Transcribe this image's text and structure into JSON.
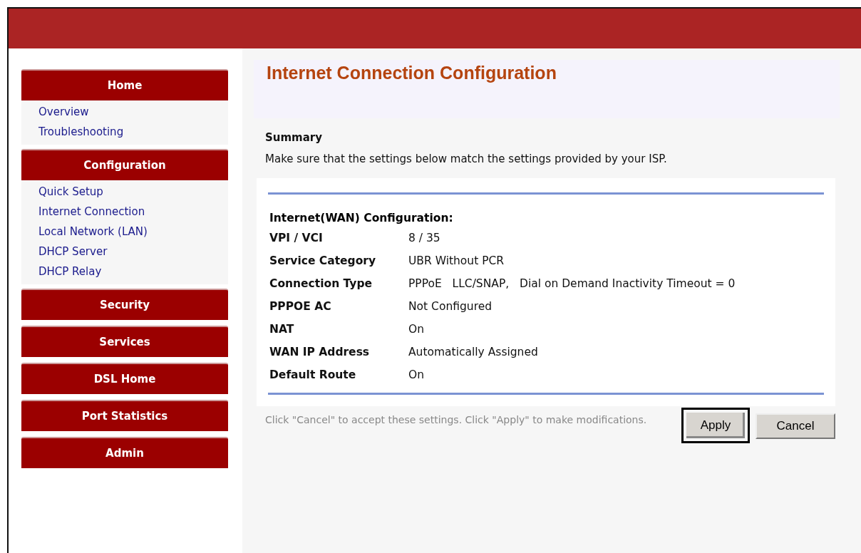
{
  "sidebar": {
    "sections": [
      {
        "title": "Home",
        "items": [
          "Overview",
          "Troubleshooting"
        ]
      },
      {
        "title": "Configuration",
        "items": [
          "Quick Setup",
          "Internet Connection",
          "Local Network (LAN)",
          "DHCP Server",
          "DHCP Relay"
        ]
      },
      {
        "title": "Security"
      },
      {
        "title": "Services"
      },
      {
        "title": "DSL Home"
      },
      {
        "title": "Port Statistics"
      },
      {
        "title": "Admin"
      }
    ]
  },
  "page": {
    "title": "Internet Connection Configuration",
    "subtitle": "Summary",
    "intro": "Make sure that the settings below match the settings provided by your ISP.",
    "table": {
      "heading": "Internet(WAN) Configuration:",
      "rows": [
        {
          "label": "VPI / VCI",
          "value": "8 / 35"
        },
        {
          "label": "Service Category",
          "value": "UBR Without PCR"
        },
        {
          "label": "Connection Type",
          "value": "PPPoE   LLC/SNAP,   Dial on Demand Inactivity Timeout = 0"
        },
        {
          "label": "PPPOE AC",
          "value": "Not Configured"
        },
        {
          "label": "NAT",
          "value": "On"
        },
        {
          "label": "WAN IP Address",
          "value": "Automatically Assigned"
        },
        {
          "label": "Default Route",
          "value": "On"
        }
      ]
    },
    "footer_note": "Click \"Cancel\" to accept these settings. Click \"Apply\" to make modifications.",
    "buttons": [
      {
        "label": "Apply",
        "focused": true
      },
      {
        "label": "Cancel",
        "focused": false
      }
    ]
  }
}
